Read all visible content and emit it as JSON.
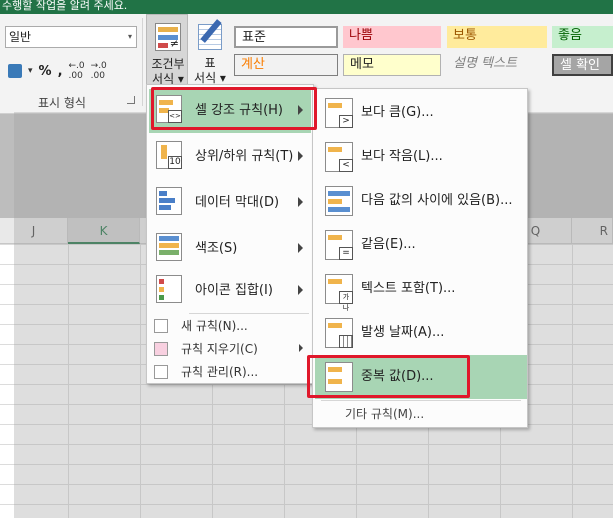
{
  "window": {
    "title_partial": "수행할 작업을 알려 주세요."
  },
  "ribbon": {
    "number_group": {
      "format_value": "일반",
      "percent_label": "%",
      "comma_label": ",",
      "increase_decimal_label": ".00",
      "decrease_decimal_label": ".00",
      "increase_decimal_prefix": "←.0",
      "decrease_decimal_prefix": "→.0",
      "group_label": "표시 형식"
    },
    "conditional_format": {
      "line1": "조건부",
      "line2": "서식 ▾"
    },
    "format_as_table": {
      "line1": "표",
      "line2": "서식 ▾"
    },
    "cell_styles": {
      "normal": "표준",
      "bad": "나쁨",
      "neutral": "보통",
      "good": "좋음",
      "calculation": "계산",
      "note": "메모",
      "explanatory": "설명 텍스트",
      "check_cell": "셀 확인"
    }
  },
  "columns": [
    "J",
    "K",
    "",
    "",
    "",
    "",
    "",
    "Q",
    "R"
  ],
  "menu": {
    "items": [
      {
        "label": "셀 강조 규칙(H)"
      },
      {
        "label": "상위/하위 규칙(T)"
      },
      {
        "label": "데이터 막대(D)"
      },
      {
        "label": "색조(S)"
      },
      {
        "label": "아이콘 집합(I)"
      }
    ],
    "small_items": [
      {
        "label": "새 규칙(N)..."
      },
      {
        "label": "규칙 지우기(C)"
      },
      {
        "label": "규칙 관리(R)..."
      }
    ]
  },
  "submenu": {
    "items": [
      {
        "label": "보다 큼(G)..."
      },
      {
        "label": "보다 작음(L)..."
      },
      {
        "label": "다음 값의 사이에 있음(B)..."
      },
      {
        "label": "같음(E)..."
      },
      {
        "label": "텍스트 포함(T)..."
      },
      {
        "label": "발생 날짜(A)..."
      },
      {
        "label": "중복 값(D)..."
      }
    ],
    "more": "기타 규칙(M)...",
    "glyphs": {
      "greater": ">",
      "less": "<",
      "equal": "=",
      "text": "가나",
      "top10": "10"
    }
  },
  "colors": {
    "excel_green": "#217346",
    "highlight_red": "#e0182b",
    "active_item": "#a8d5b4"
  }
}
